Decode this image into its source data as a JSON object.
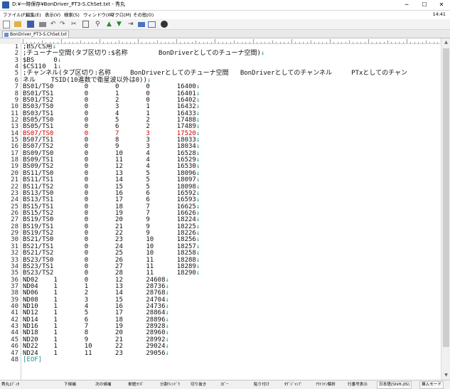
{
  "window": {
    "title": "D:¥一時保存¥BonDriver_PT3-S.ChSet.txt - 秀丸",
    "minimize": "─",
    "maximize": "☐",
    "close": "✕"
  },
  "menu": {
    "items": [
      "ファイル(F)",
      "編集(E)",
      "表示(V)",
      "検索(S)",
      "ウィンドウ(W)",
      "マクロ(M)",
      "その他(O)"
    ],
    "clock": "14:41"
  },
  "toolbar": {
    "icons": [
      "new-file-icon",
      "open-icon",
      "save-icon",
      "print-icon",
      "undo-icon",
      "redo-icon",
      "cut-icon",
      "copy-icon",
      "paste-icon",
      "find-icon",
      "find-prev-icon",
      "find-next-icon",
      "jump-icon",
      "grep-icon",
      "window-icon",
      "settings-icon",
      "help-icon"
    ]
  },
  "tab": {
    "label": "BonDriver_PT3-S.ChSet.txt"
  },
  "editor": {
    "current_line": 14,
    "lines": [
      ";BS/CS用",
      ";チューナー空間(タブ区切り:$名称\tBonDriverとしてのチューナ空間)",
      "$BS\t0",
      "$CS110\t1",
      ";チャンネル(タブ区切り:名称\tBonDriverとしてのチューナ空間\tBonDriverとしてのチャンネル\tPTxとしてのチャン",
      "ネル\tTSID(10進数で衛星波以外は0))",
      "BS01/TS0\t0\t0\t0\t16400",
      "BS01/TS1\t0\t1\t0\t16401",
      "BS01/TS2\t0\t2\t0\t16402",
      "BS03/TS0\t0\t3\t1\t16432",
      "BS03/TS1\t0\t4\t1\t16433",
      "BS05/TS0\t0\t5\t2\t17488",
      "BS05/TS1\t0\t6\t2\t17489",
      "BS07/TS0\t0\t7\t3\t17520",
      "BS07/TS1\t0\t8\t3\t18033",
      "BS07/TS2\t0\t9\t3\t18034",
      "BS09/TS0\t0\t10\t4\t16528",
      "BS09/TS1\t0\t11\t4\t16529",
      "BS09/TS2\t0\t12\t4\t16530",
      "BS11/TS0\t0\t13\t5\t18096",
      "BS11/TS1\t0\t14\t5\t18097",
      "BS11/TS2\t0\t15\t5\t18098",
      "BS13/TS0\t0\t16\t6\t16592",
      "BS13/TS1\t0\t17\t6\t16593",
      "BS15/TS1\t0\t18\t7\t16625",
      "BS15/TS2\t0\t19\t7\t16626",
      "BS19/TS0\t0\t20\t9\t18224",
      "BS19/TS1\t0\t21\t9\t18225",
      "BS19/TS2\t0\t22\t9\t18226",
      "BS21/TS0\t0\t23\t10\t18256",
      "BS21/TS1\t0\t24\t10\t18257",
      "BS21/TS2\t0\t25\t10\t18258",
      "BS23/TS0\t0\t26\t11\t18288",
      "BS23/TS1\t0\t27\t11\t18289",
      "BS23/TS2\t0\t28\t11\t18290",
      "ND02\t1\t0\t12\t24608",
      "ND04\t1\t1\t13\t28736",
      "ND06\t1\t2\t14\t28768",
      "ND08\t1\t3\t15\t24704",
      "ND10\t1\t4\t16\t24736",
      "ND12\t1\t5\t17\t28864",
      "ND14\t1\t6\t18\t28896",
      "ND16\t1\t7\t19\t28928",
      "ND18\t1\t8\t20\t28960",
      "ND20\t1\t9\t21\t28992",
      "ND22\t1\t10\t22\t29024",
      "ND24\t1\t11\t23\t29056",
      "[EOF]"
    ],
    "newline_mark": "↓"
  },
  "status": {
    "items": [
      "秀丸ｴﾃﾞｨﾀ",
      "下候補",
      "次の候補",
      "単語ﾖﾐﾎﾞ",
      "分割ｳｨﾝﾄﾞｳ",
      "切り抜き",
      "ｺﾋﾟｰ",
      "貼り付け",
      "ﾀｸﾞｼﾞｬﾝﾌﾟ",
      "ｱｳﾄﾗｲﾝ解析",
      "行番号表示",
      "日本語(Shift-JIS)",
      "挿入モード"
    ]
  }
}
